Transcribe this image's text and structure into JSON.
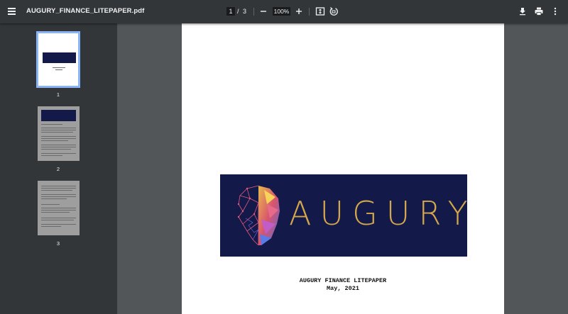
{
  "toolbar": {
    "title": "AUGURY_FINANCE_LITEPAPER.pdf",
    "current_page": "1",
    "page_separator": "/",
    "total_pages": "3",
    "zoom": "100%",
    "icons": [
      "menu-icon",
      "zoom-out-icon",
      "zoom-in-icon",
      "fit-page-icon",
      "rotate-icon",
      "download-icon",
      "print-icon",
      "more-vert-icon"
    ]
  },
  "sidebar": {
    "thumbnails": [
      {
        "label": "1",
        "selected": true
      },
      {
        "label": "2",
        "selected": false
      },
      {
        "label": "3",
        "selected": false
      }
    ]
  },
  "page": {
    "logo_text": "AUGURY",
    "caption_title": "AUGURY FINANCE LITEPAPER",
    "caption_date": "May, 2021"
  },
  "colors": {
    "toolbar_bg": "#323639",
    "viewer_bg": "#525659",
    "logo_bg": "#131a4a",
    "logo_text": "#d4a84a",
    "thumb_selected_border": "#8ab4f8"
  }
}
